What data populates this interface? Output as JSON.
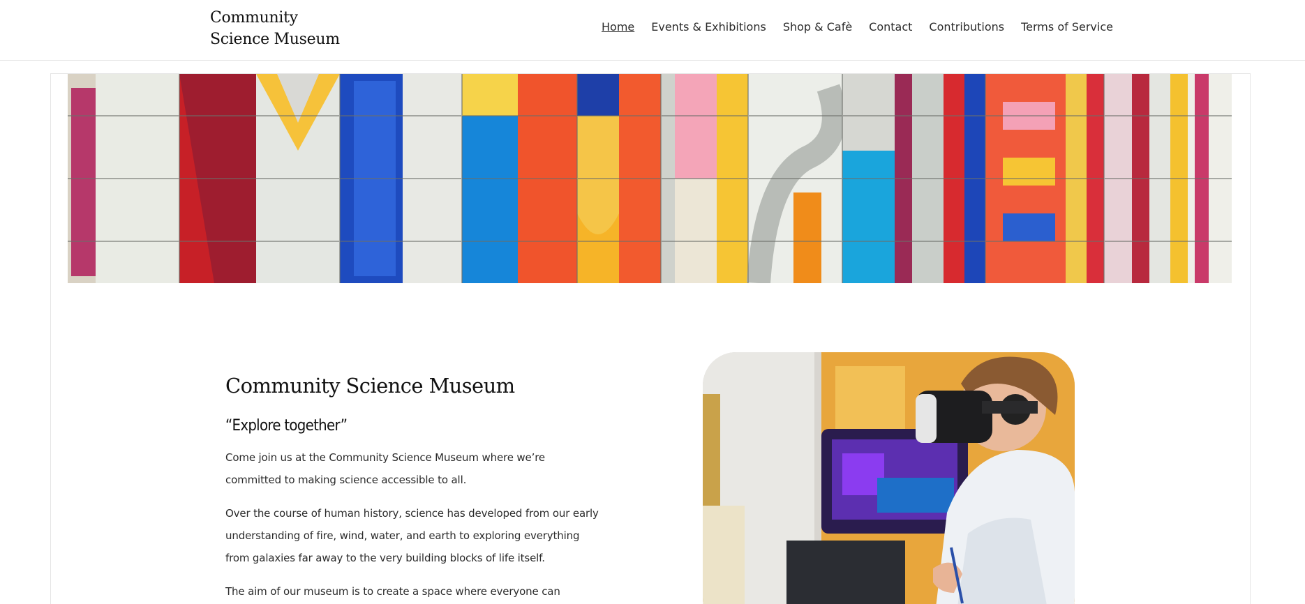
{
  "site": {
    "title_line1": "Community",
    "title_line2": "Science Museum"
  },
  "nav": {
    "items": [
      {
        "label": "Home",
        "current": true
      },
      {
        "label": "Events & Exhibitions"
      },
      {
        "label": "Shop & Cafè"
      },
      {
        "label": "Contact"
      },
      {
        "label": "Contributions"
      },
      {
        "label": "Terms of Service"
      }
    ]
  },
  "banner": {
    "image": "colorful-museum-lettering-facade"
  },
  "intro": {
    "heading": "Community Science Museum",
    "tagline": "“Explore together”",
    "paragraphs": [
      "Come join us at the Community Science Museum where we’re committed to making science accessible to all.",
      "Over the course of human history, science has developed from our early understanding of fire, wind, water, and earth to exploring everything from galaxies far away to the very building blocks of life itself.",
      "The aim of our museum is to create a space where everyone can"
    ]
  },
  "photo": {
    "image": "person-wearing-vr-headset-painting"
  },
  "colors": {
    "text": "#222222",
    "border": "#e6e6e6",
    "background": "#ffffff"
  }
}
